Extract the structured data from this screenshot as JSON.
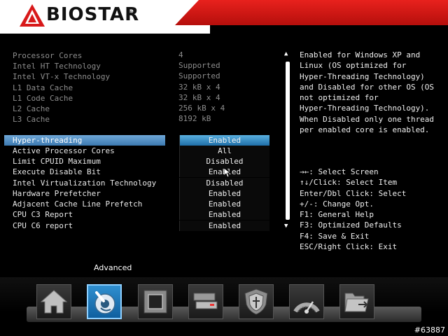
{
  "brand": {
    "name": "BIOSTAR",
    "reg": "®"
  },
  "info_rows": [
    {
      "label": "Processor Cores",
      "value": "4"
    },
    {
      "label": "Intel HT Technology",
      "value": "Supported"
    },
    {
      "label": "Intel VT-x Technology",
      "value": "Supported"
    },
    {
      "label": "L1 Data Cache",
      "value": "32 kB x 4"
    },
    {
      "label": "L1 Code Cache",
      "value": "32 kB x 4"
    },
    {
      "label": "L2 Cache",
      "value": "256 kB x 4"
    },
    {
      "label": "L3 Cache",
      "value": "8192 kB"
    }
  ],
  "options": [
    {
      "label": "Hyper-threading",
      "value": "Enabled",
      "selected": true
    },
    {
      "label": "Active Processor Cores",
      "value": "All"
    },
    {
      "label": "Limit CPUID Maximum",
      "value": "Disabled"
    },
    {
      "label": "Execute Disable Bit",
      "value": "Enabled"
    },
    {
      "label": "Intel Virtualization Technology",
      "value": "Disabled"
    },
    {
      "label": "Hardware Prefetcher",
      "value": "Enabled"
    },
    {
      "label": "Adjacent Cache Line Prefetch",
      "value": "Enabled"
    },
    {
      "label": "CPU C3 Report",
      "value": "Enabled"
    },
    {
      "label": "CPU C6 report",
      "value": "Enabled"
    }
  ],
  "help_lines": [
    "Enabled for Windows XP and",
    "Linux (OS optimized for",
    "Hyper-Threading Technology)",
    "and Disabled for other OS (OS",
    "not optimized for",
    "Hyper-Threading Technology).",
    "When Disabled only one thread",
    "per enabled core is enabled."
  ],
  "key_lines": [
    "→←: Select Screen",
    "↑↓/Click: Select Item",
    "Enter/Dbl Click: Select",
    "+/-: Change Opt.",
    "F1: General Help",
    "F3: Optimized Defaults",
    "F4: Save & Exit",
    "ESC/Right Click: Exit"
  ],
  "active_tab": "Advanced",
  "nav_icons": [
    "home-icon",
    "advanced-icon",
    "chipset-icon",
    "boot-icon",
    "security-icon",
    "o-n-e-icon",
    "save-exit-icon"
  ],
  "watermark": "#63887",
  "colors": {
    "accent_red": "#d8191a",
    "select_blue": "#3c79b0"
  }
}
